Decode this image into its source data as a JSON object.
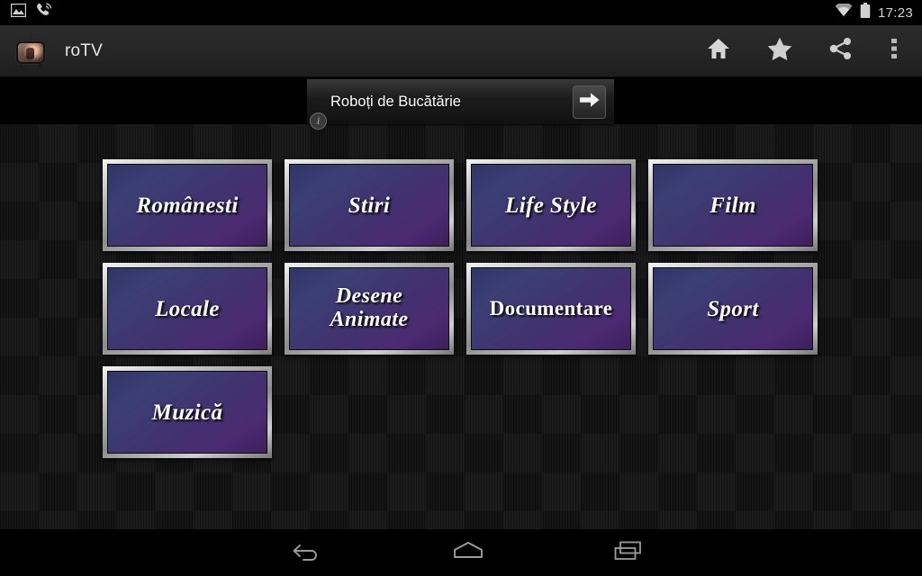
{
  "status_bar": {
    "icons": [
      "image-icon",
      "phone-call-icon",
      "wifi-icon",
      "battery-icon"
    ],
    "clock": "17:23"
  },
  "action_bar": {
    "app_icon": "retro-tv-app-icon",
    "title": "roTV",
    "buttons": [
      {
        "name": "home-icon",
        "label": "Home"
      },
      {
        "name": "star-icon",
        "label": "Favorites"
      },
      {
        "name": "share-icon",
        "label": "Share"
      },
      {
        "name": "overflow-menu-icon",
        "label": "More options"
      }
    ]
  },
  "ad_banner": {
    "text": "Roboți de Bucătărie",
    "cta_icon": "arrow-right-icon",
    "info_badge": "i"
  },
  "categories": [
    {
      "label": "Românesti",
      "style": "italic"
    },
    {
      "label": "Stiri",
      "style": "italic"
    },
    {
      "label": "Life Style",
      "style": "italic"
    },
    {
      "label": "Film",
      "style": "italic"
    },
    {
      "label": "Locale",
      "style": "italic"
    },
    {
      "label": "Desene\nAnimate",
      "style": "italic-two-line"
    },
    {
      "label": "Documentare",
      "style": "upright"
    },
    {
      "label": "Sport",
      "style": "italic"
    },
    {
      "label": "Muzică",
      "style": "italic"
    }
  ],
  "nav_bar": {
    "back": "back-icon",
    "home": "home-outline-icon",
    "recent": "recent-apps-icon"
  },
  "colors": {
    "tile_gradient_start": "#2e3566",
    "tile_gradient_end": "#3d1f5c",
    "tile_frame": "#cfcfcf",
    "action_bar": "#262626",
    "background": "#151515",
    "text": "#ffffff"
  }
}
